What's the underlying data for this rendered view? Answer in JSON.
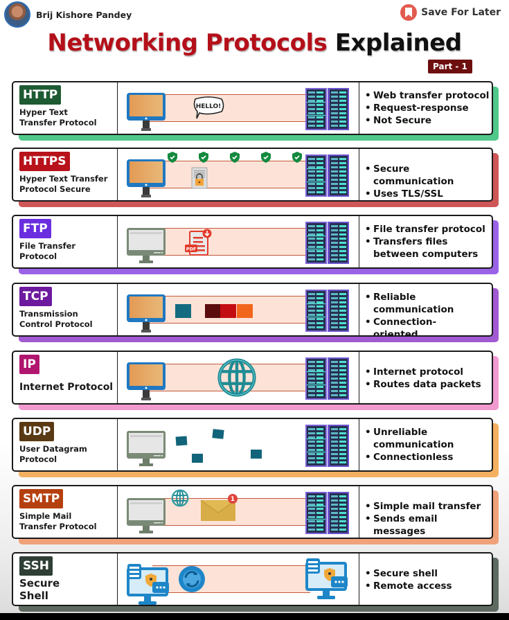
{
  "header": {
    "author": "Brij Kishore Pandey",
    "save_label": "Save For Later",
    "title_red": "Networking Protocols",
    "title_black": "Explained",
    "part_label": "Part - 1"
  },
  "colors": {
    "title_red": "#b4101a",
    "part_badge": "#6e0f0f",
    "save_icon": "#e25b4f"
  },
  "protocols": [
    {
      "abbr": "HTTP",
      "name": "Hyper Text Transfer Protocol",
      "badge_color": "#1e5a32",
      "accent_color": "#4fc88a",
      "points": [
        "Web transfer protocol",
        "Request-response",
        "Not Secure"
      ],
      "illustration": {
        "sender": "blue-monitor-icon",
        "payload": "hello-speech-bubble-icon",
        "payload_text": "HELLO!",
        "receiver": "server-rack-icon"
      }
    },
    {
      "abbr": "HTTPS",
      "name": "Hyper Text Transfer Protocol Secure",
      "badge_color": "#b8121b",
      "accent_color": "#cf5656",
      "points": [
        "Secure communication",
        "Uses TLS/SSL encryption"
      ],
      "illustration": {
        "sender": "blue-monitor-icon",
        "payload": "locked-document-icon",
        "extras": "shield-check-icons",
        "shield_count": 5,
        "receiver": "server-rack-icon"
      }
    },
    {
      "abbr": "FTP",
      "name": "File Transfer Protocol",
      "badge_color": "#6a2ee0",
      "accent_color": "#9a63e6",
      "points": [
        "File transfer protocol",
        "Transfers files between computers"
      ],
      "illustration": {
        "sender": "grey-monitor-icon",
        "payload": "pdf-download-icon",
        "payload_text": "PDF",
        "receiver": "server-rack-icon"
      }
    },
    {
      "abbr": "TCP",
      "name": "Transmission Control Protocol",
      "badge_color": "#6d1a9e",
      "accent_color": "#a15ad2",
      "points": [
        "Reliable communication",
        "Connection-oriented"
      ],
      "illustration": {
        "sender": "blue-monitor-icon",
        "payload": "ordered-packets-icon",
        "receiver": "server-rack-icon"
      }
    },
    {
      "abbr": "IP",
      "name": "Internet Protocol",
      "badge_color": "#b0166e",
      "accent_color": "#f09ad0",
      "points": [
        "Internet protocol",
        "Routes data packets"
      ],
      "illustration": {
        "sender": "blue-monitor-icon",
        "payload": "globe-icon",
        "receiver": "server-rack-icon"
      }
    },
    {
      "abbr": "UDP",
      "name": "User Datagram Protocol",
      "badge_color": "#5a3a14",
      "accent_color": "#f4b060",
      "points": [
        "Unreliable communication",
        "Connectionless"
      ],
      "illustration": {
        "sender": "grey-monitor-icon",
        "payload": "scattered-packets-icon",
        "receiver": "server-rack-icon"
      }
    },
    {
      "abbr": "SMTP",
      "name": "Simple Mail Transfer Protocol",
      "badge_color": "#b5400f",
      "accent_color": "#f0a27a",
      "points": [
        "Simple mail transfer",
        "Sends email messages"
      ],
      "illustration": {
        "sender": "grey-monitor-icon",
        "payload": "envelope-icon",
        "notification_count": "1",
        "extras": "globe-icon",
        "receiver": "server-rack-icon"
      }
    },
    {
      "abbr": "SSH",
      "name": "Secure Shell",
      "badge_color": "#2f3f36",
      "accent_color": "#5e6a60",
      "points": [
        "Secure shell",
        "Remote access"
      ],
      "illustration": {
        "sender": "secure-terminal-monitor-icon",
        "payload": "sync-arrows-icon",
        "receiver": "secure-terminal-monitor-icon"
      }
    }
  ]
}
